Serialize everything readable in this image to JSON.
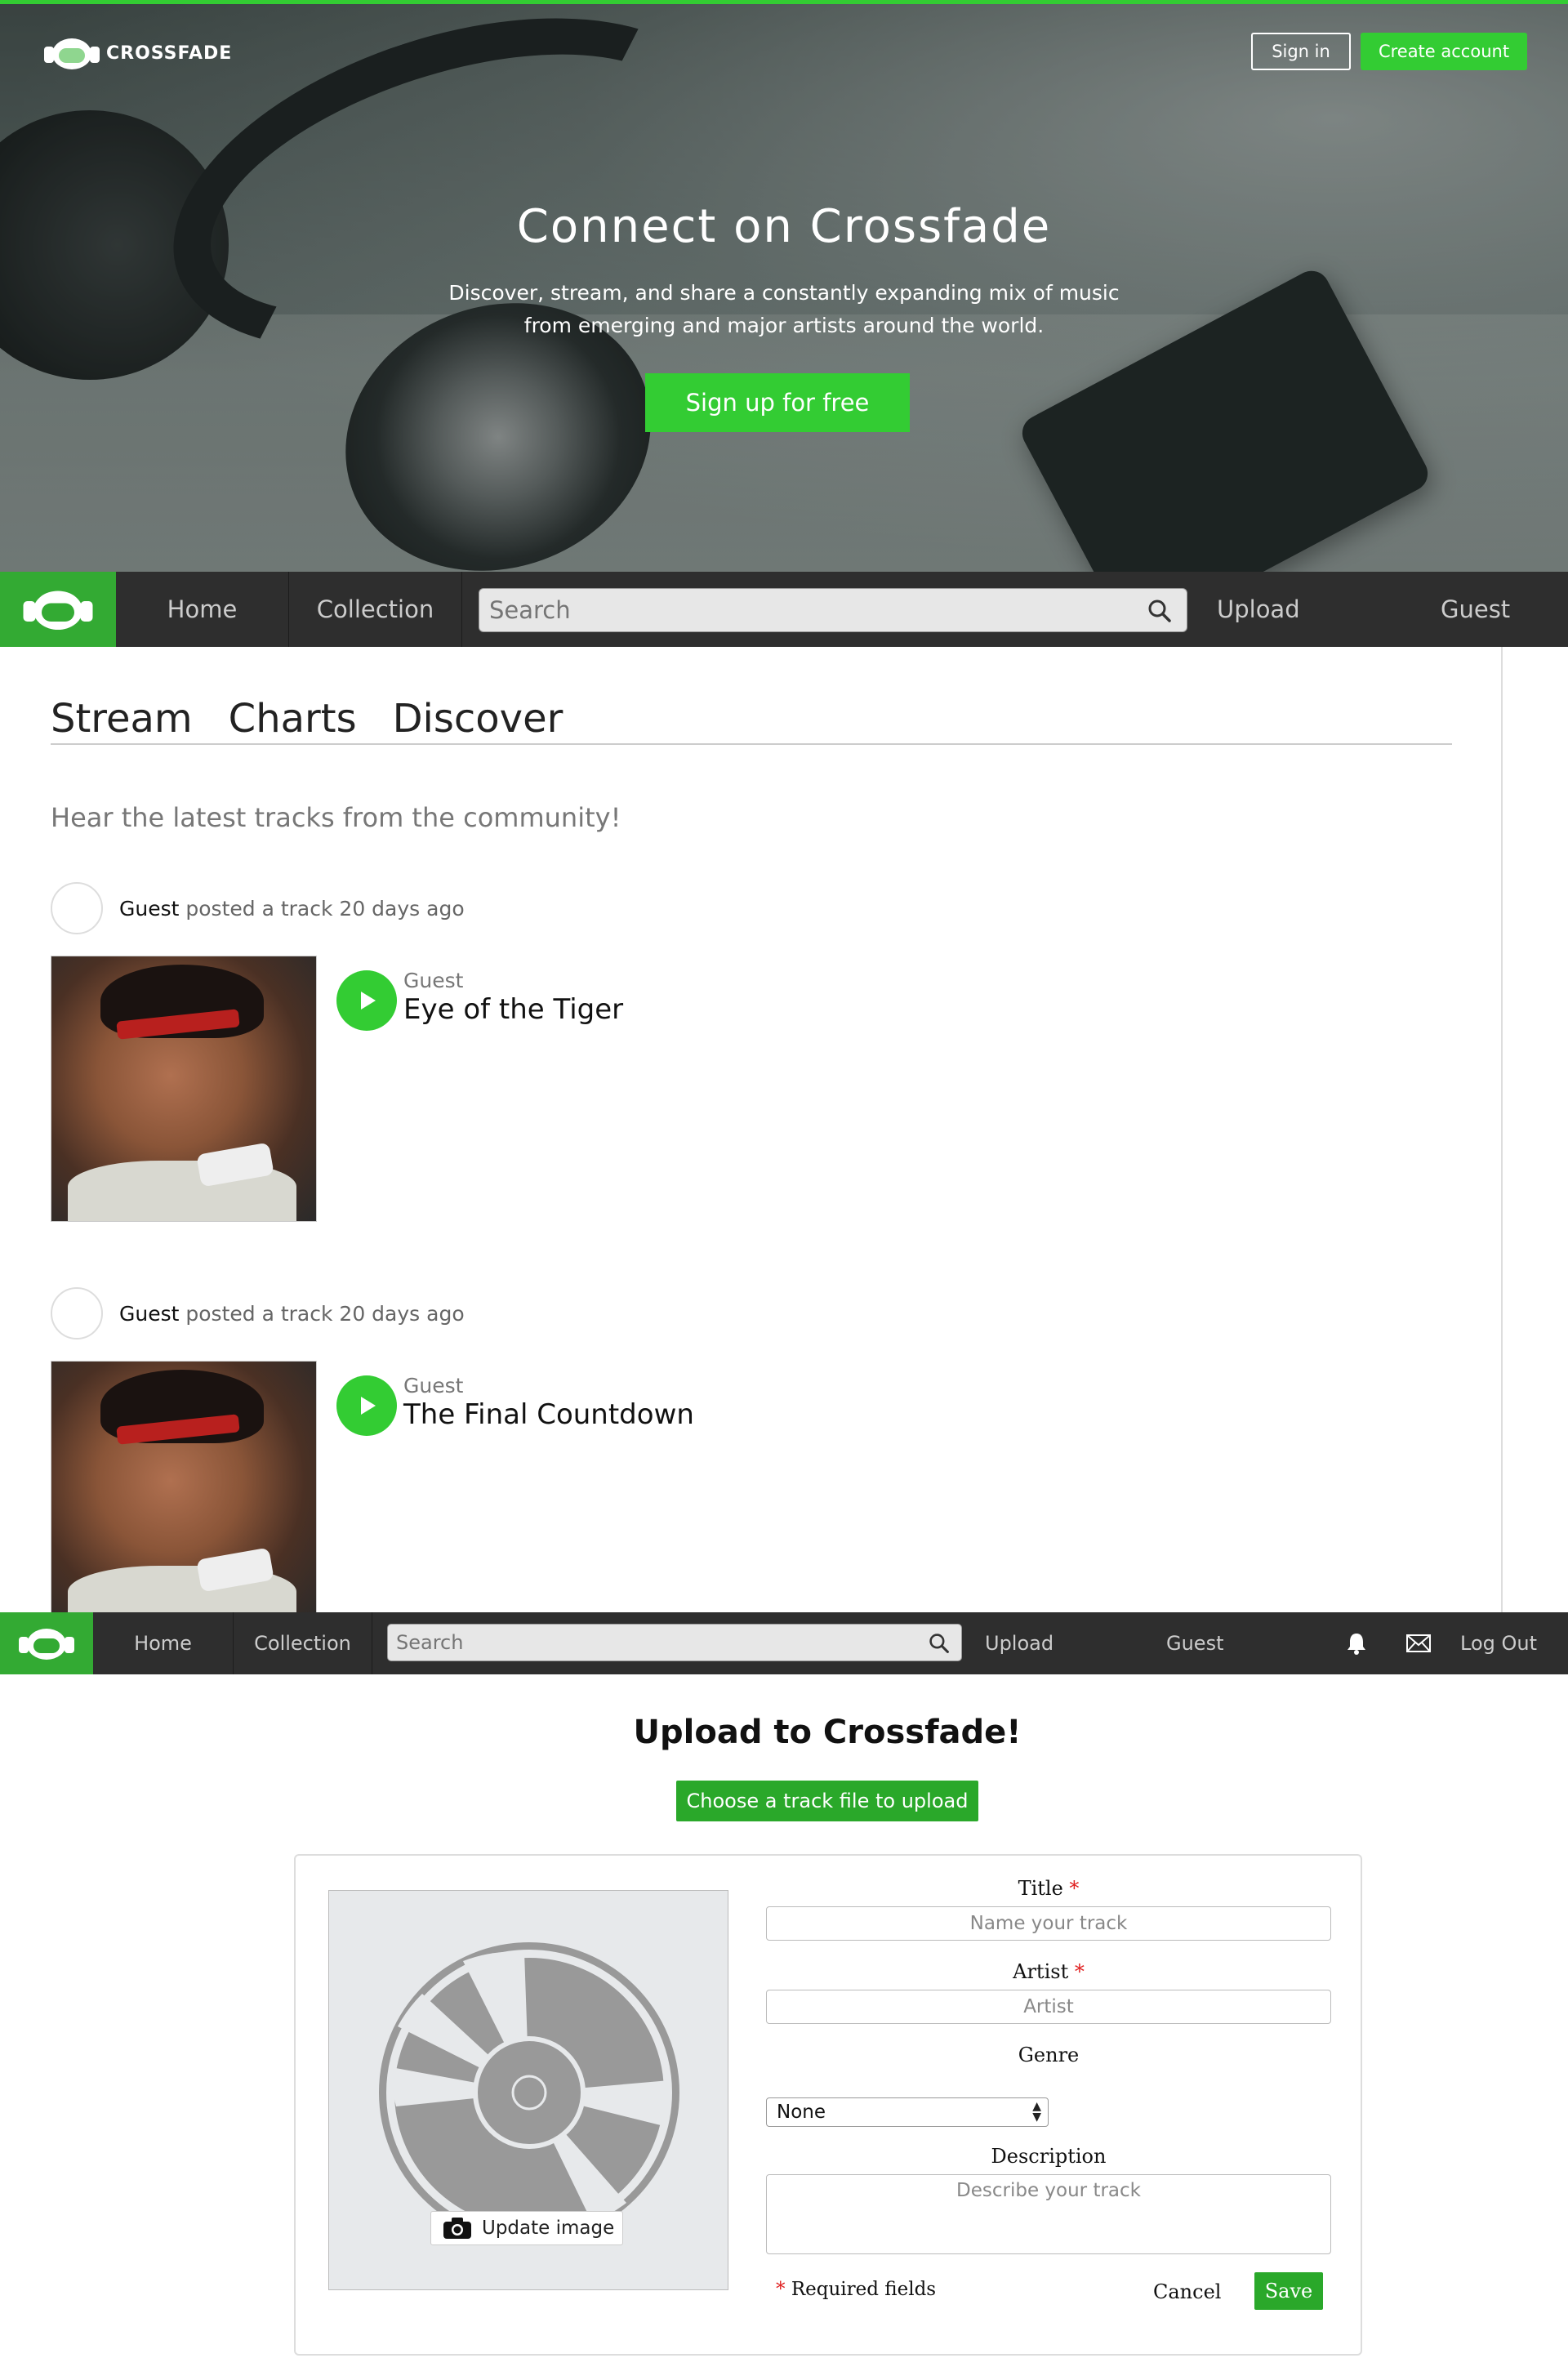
{
  "hero": {
    "brand": "CROSSFADE",
    "sign_in": "Sign in",
    "create_account": "Create account",
    "title": "Connect on Crossfade",
    "subtitle_line1": "Discover, stream, and share a constantly expanding mix of music",
    "subtitle_line2": "from emerging and major artists around the world.",
    "cta": "Sign up for free"
  },
  "nav_main": {
    "home": "Home",
    "collection": "Collection",
    "search_placeholder": "Search",
    "upload": "Upload",
    "guest": "Guest"
  },
  "stream": {
    "tabs": [
      "Stream",
      "Charts",
      "Discover"
    ],
    "intro": "Hear the latest tracks from the community!",
    "posts": [
      {
        "user": "Guest",
        "action": "posted a track 20 days ago",
        "artist": "Guest",
        "title": "Eye of the Tiger"
      },
      {
        "user": "Guest",
        "action": "posted a track 20 days ago",
        "artist": "Guest",
        "title": "The Final Countdown"
      }
    ]
  },
  "nav_upload": {
    "home": "Home",
    "collection": "Collection",
    "search_placeholder": "Search",
    "upload": "Upload",
    "guest": "Guest",
    "logout": "Log Out"
  },
  "upload": {
    "title": "Upload to Crossfade!",
    "choose_file": "Choose a track file to upload",
    "update_image": "Update image",
    "title_label": "Title",
    "title_placeholder": "Name your track",
    "artist_label": "Artist",
    "artist_placeholder": "Artist",
    "genre_label": "Genre",
    "genre_value": "None",
    "description_label": "Description",
    "description_placeholder": "Describe your track",
    "required_marker": "*",
    "required_note": "Required fields",
    "cancel": "Cancel",
    "save": "Save"
  },
  "colors": {
    "brand_green": "#33cc33",
    "nav_dark": "#2e2e2e",
    "required_red": "#e02020"
  }
}
